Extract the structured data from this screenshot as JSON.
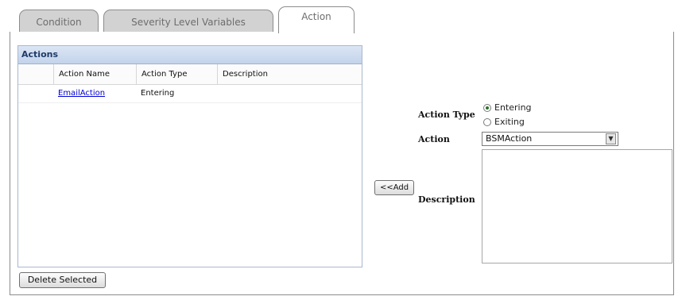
{
  "tabs": [
    {
      "label": "Condition"
    },
    {
      "label": "Severity Level Variables"
    },
    {
      "label": "Action"
    }
  ],
  "actions_grid": {
    "title": "Actions",
    "columns": [
      "Action Name",
      "Action Type",
      "Description"
    ],
    "rows": [
      {
        "name": "EmailAction",
        "type": "Entering",
        "description": ""
      }
    ]
  },
  "buttons": {
    "delete_selected": "Delete Selected",
    "add": "<<Add"
  },
  "form": {
    "action_type_label": "Action Type",
    "action_type_options": [
      "Entering",
      "Exiting"
    ],
    "action_type_selected": "Entering",
    "action_label": "Action",
    "action_value": "BSMAction",
    "description_label": "Description",
    "description_value": ""
  }
}
